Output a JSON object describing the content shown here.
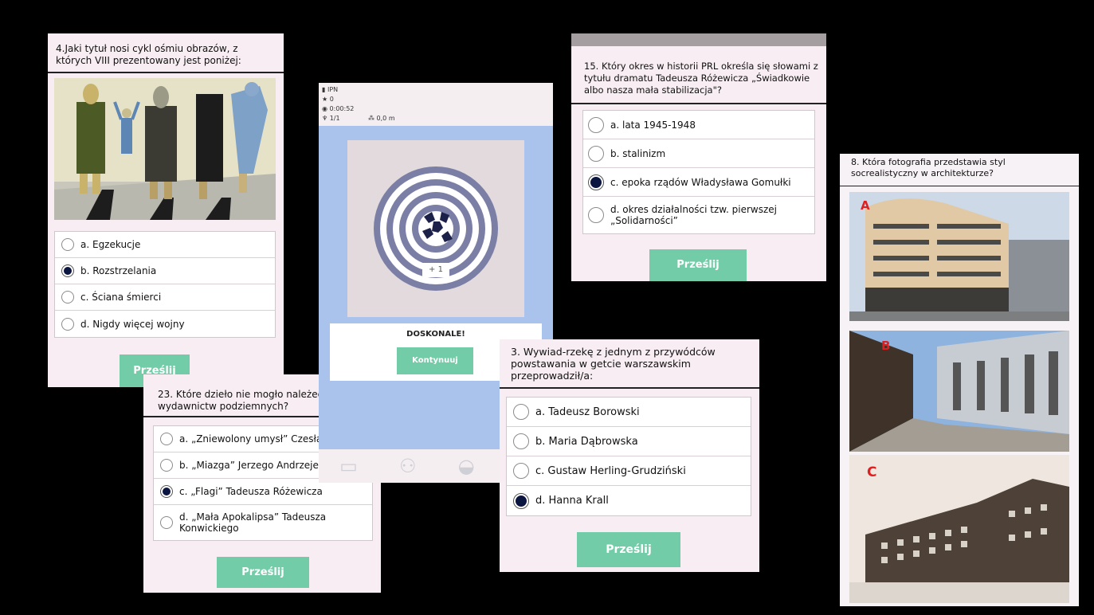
{
  "card1": {
    "question": "4.Jaki tytuł nosi cykl ośmiu obrazów, z których VIII prezentowany jest poniżej:",
    "options": [
      {
        "label": "a. Egzekucje",
        "selected": false
      },
      {
        "label": "b. Rozstrzelania",
        "selected": true
      },
      {
        "label": "c. Ściana śmierci",
        "selected": false
      },
      {
        "label": "d. Nigdy więcej wojny",
        "selected": false
      }
    ],
    "submit": "Prześlij"
  },
  "card2": {
    "question": "23. Które dzieło nie mogło należeć d wydawnictw podziemnych?",
    "options": [
      {
        "label": "a. „Zniewolony umysł” Czesław",
        "selected": false
      },
      {
        "label": "b. „Miazga” Jerzego Andrzejew",
        "selected": false
      },
      {
        "label": "c. „Flagi” Tadeusza Różewicza",
        "selected": true
      },
      {
        "label": "d. „Mała Apokalipsa” Tadeusza Konwickiego",
        "selected": false
      }
    ],
    "submit": "Prześlij"
  },
  "game": {
    "stats": {
      "user": "IPN",
      "score": "0",
      "time": "0:00:52",
      "progress": "1/1",
      "distance": "0,0 m"
    },
    "points": "+ 1",
    "result": "DOSKONALE!",
    "continue": "Kontynuuj",
    "nav_icons": [
      "briefcase-icon",
      "people-icon",
      "chat-icon",
      "gear-icon"
    ]
  },
  "card3": {
    "question": "15. Który okres w historii PRL określa się słowami z tytułu dramatu Tadeusza Różewicza „Świadkowie albo nasza mała stabilizacja\"?",
    "options": [
      {
        "label": "a. lata 1945-1948",
        "selected": false
      },
      {
        "label": "b. stalinizm",
        "selected": false
      },
      {
        "label": "c. epoka rządów Władysława Gomułki",
        "selected": true
      },
      {
        "label": "d. okres działalności tzw. pierwszej „Solidarności”",
        "selected": false
      }
    ],
    "submit": "Prześlij"
  },
  "card4": {
    "question": "3. Wywiad-rzekę z jednym z przywódców powstawania w getcie warszawskim przeprowadził/a:",
    "options": [
      {
        "label": "a. Tadeusz Borowski",
        "selected": false
      },
      {
        "label": "b. Maria Dąbrowska",
        "selected": false
      },
      {
        "label": "c. Gustaw Herling-Grudziński",
        "selected": false
      },
      {
        "label": "d. Hanna Krall",
        "selected": true
      }
    ],
    "submit": "Prześlij"
  },
  "card5": {
    "question": "8. Która fotografia przedstawia styl socrealistyczny w architekturze?",
    "photos": [
      "A",
      "B",
      "C"
    ]
  },
  "colors": {
    "accent": "#72cca8",
    "selected_radio": "#0a1540",
    "card_bg": "#f7edf2",
    "game_blue": "#a9c3ec"
  }
}
